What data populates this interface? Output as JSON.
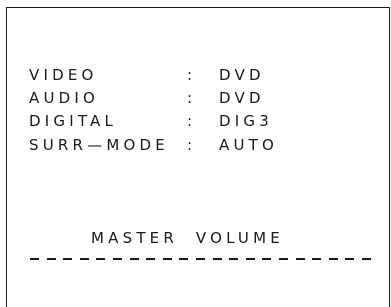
{
  "osd": {
    "rows": [
      {
        "label": "VIDEO",
        "separator": ":",
        "value": "DVD"
      },
      {
        "label": "AUDIO",
        "separator": ":",
        "value": "DVD"
      },
      {
        "label": "DIGITAL",
        "separator": ":",
        "value": "DIG3"
      },
      {
        "label": "SURR—MODE",
        "separator": ":",
        "value": "AUTO"
      }
    ],
    "master_volume_label": "MASTER  VOLUME",
    "volume_bar_segments": 21
  }
}
